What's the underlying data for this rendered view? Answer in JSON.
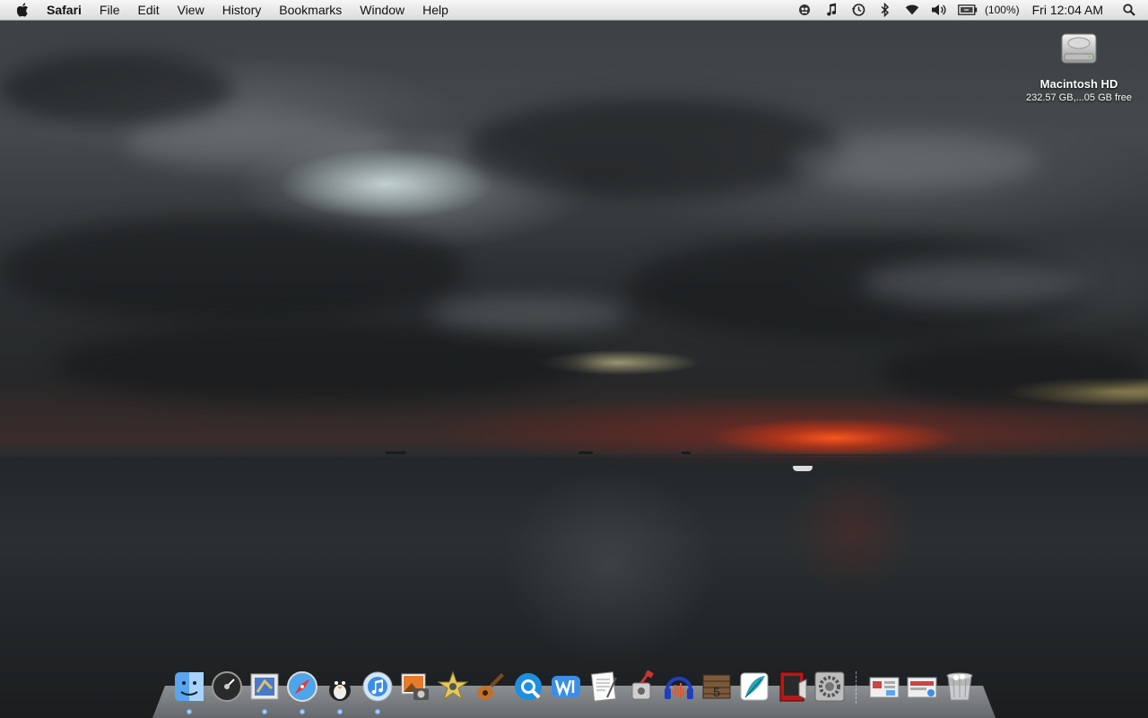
{
  "menubar": {
    "app_name": "Safari",
    "menus": [
      "File",
      "Edit",
      "View",
      "History",
      "Bookmarks",
      "Window",
      "Help"
    ],
    "battery_text": "(100%)",
    "clock": "Fri 12:04 AM",
    "status_icons": [
      "monitor-icon",
      "music-note-icon",
      "time-machine-icon",
      "bluetooth-icon",
      "wifi-icon",
      "volume-icon",
      "battery-icon",
      "spotlight-icon"
    ]
  },
  "desktop": {
    "drive_name": "Macintosh HD",
    "drive_info": "232.57 GB,...05 GB free"
  },
  "dock": {
    "apps": [
      "Finder",
      "Dashboard",
      "Mail",
      "Safari",
      "Adium",
      "iTunes",
      "iPhoto",
      "iMovie",
      "GarageBand",
      "QuickTime",
      "Word",
      "TextEdit",
      "Automator",
      "Audacity",
      "Logic",
      "Feather",
      "Photo Booth",
      "System Preferences"
    ],
    "docs": [
      "Desktop",
      "Documents",
      "Trash"
    ]
  }
}
